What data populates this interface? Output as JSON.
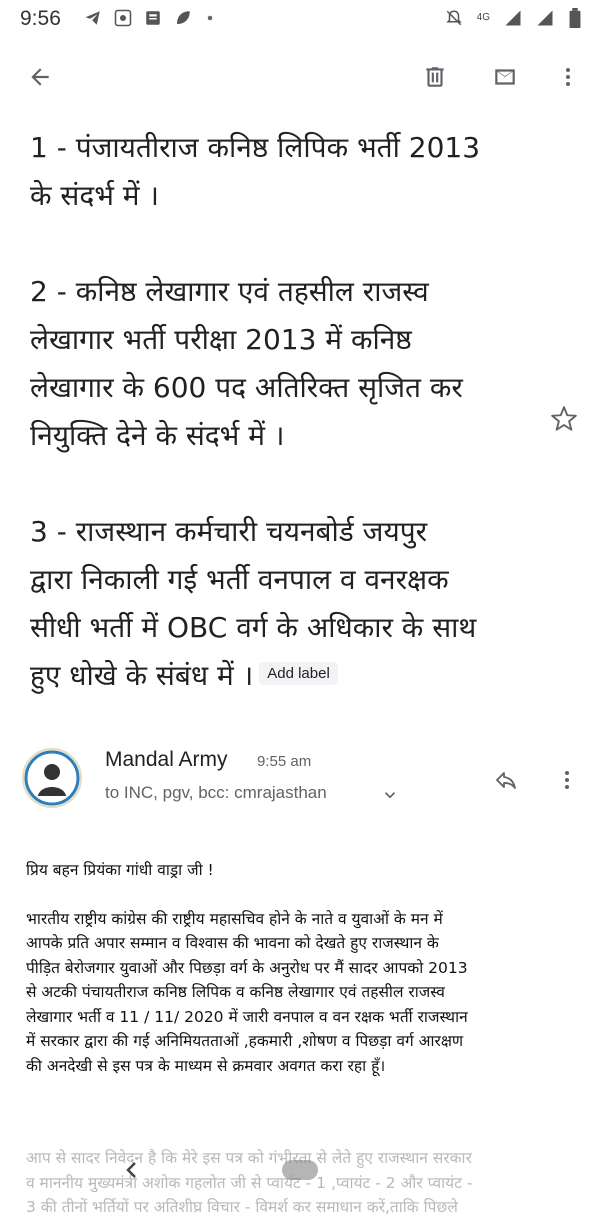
{
  "status_bar": {
    "time": "9:56",
    "network": "4G"
  },
  "toolbar": {
    "back_icon": "arrow-back-icon",
    "delete_icon": "trash-icon",
    "mark_unread_icon": "mail-icon",
    "more_icon": "more-vert-icon"
  },
  "subject": {
    "lines_1": [
      "1 - पंजायतीराज कनिष्ठ लिपिक भर्ती 2013",
      "के संदर्भ में ।"
    ],
    "lines_2": [
      "2 - कनिष्ठ लेखागार  एवं तहसील राजस्व",
      "लेखागार भर्ती परीक्षा 2013 में कनिष्ठ",
      "लेखागार के 600 पद अतिरिक्त सृजित कर",
      "नियुक्ति देने के संदर्भ में ।"
    ],
    "lines_3": [
      "3 - राजस्थान कर्मचारी चयनबोर्ड जयपुर",
      "द्वारा निकाली गई भर्ती वनपाल व वनरक्षक",
      "सीधी भर्ती में OBC वर्ग के अधिकार के साथ",
      "हुए धोखे के संबंध में ।"
    ],
    "add_label": "Add label"
  },
  "sender": {
    "name": "Mandal Army",
    "time": "9:55 am",
    "recipients": "to INC, pgv, bcc: cmrajasthan"
  },
  "body": {
    "greeting": "प्रिय बहन प्रियंका गांधी वाड्रा जी !",
    "lines": [
      "भारतीय राष्ट्रीय कांग्रेस की राष्ट्रीय महासचिव होने के नाते व युवाओं के मन में",
      "आपके प्रति अपार सम्मान व विश्वास की भावना को देखते हुए राजस्थान के",
      "पीड़ित बेरोजगार युवाओं और पिछड़ा वर्ग के अनुरोध पर मैं सादर आपको 2013",
      "से अटकी पंचायतीराज कनिष्ठ लिपिक व कनिष्ठ लेखागार एवं तहसील राजस्व",
      "लेखागार भर्ती व 11 / 11/ 2020 में जारी वनपाल व वन रक्षक भर्ती राजस्थान",
      "में सरकार द्वारा की गई अनिमियतताओं ,हकमारी ,शोषण व पिछड़ा वर्ग आरक्षण",
      "की अनदेखी से इस पत्र के माध्यम से क्रमवार अवगत करा रहा हूँ।"
    ],
    "faded_lines": [
      "आप से सादर निवेदन है कि मेरे इस पत्र को गंभीरता से लेते हुए राजस्थान सरकार",
      "व माननीय मुख्यमंत्री अशोक गहलोत जी से प्वायंट - 1 ,प्वायंट - 2 और प्वायंट -",
      "3 की तीनों भर्तियों पर अतिशीघ्र विचार - विमर्श कर समाधान करें,ताकि पिछले"
    ]
  },
  "colors": {
    "text_primary": "#202124",
    "text_secondary": "#5f6368",
    "icon": "#5f6368",
    "chip_bg": "#f1f3f4"
  }
}
